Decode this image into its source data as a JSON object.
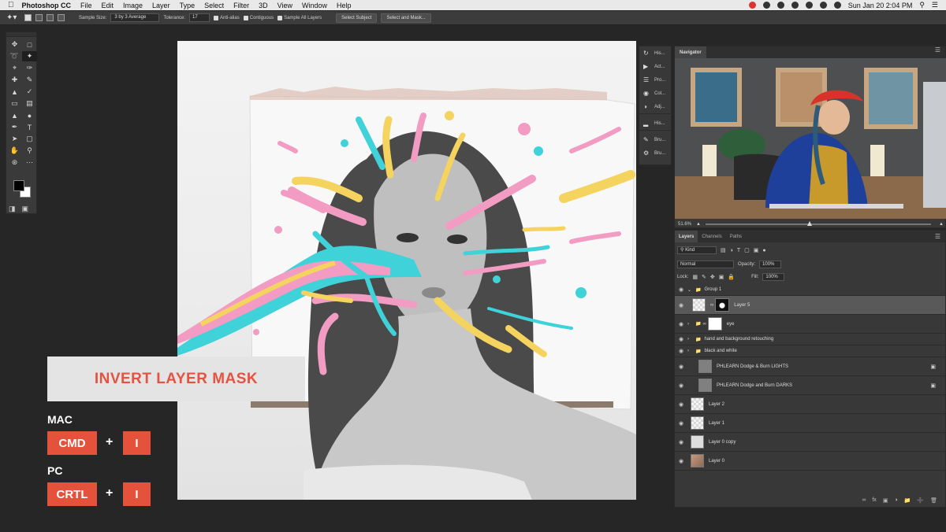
{
  "menubar": {
    "app_name": "Photoshop CC",
    "items": [
      "File",
      "Edit",
      "Image",
      "Layer",
      "Type",
      "Select",
      "Filter",
      "3D",
      "View",
      "Window",
      "Help"
    ],
    "clock": "Sun Jan 20  2:04 PM"
  },
  "options_bar": {
    "sample_size_label": "Sample Size:",
    "sample_size_value": "3 by 3 Average",
    "tolerance_label": "Tolerance:",
    "tolerance_value": "17",
    "anti_alias": "Anti-alias",
    "contiguous": "Contiguous",
    "sample_all_layers": "Sample All Layers",
    "select_subject": "Select Subject",
    "select_and_mask": "Select and Mask..."
  },
  "overlay": {
    "title": "INVERT LAYER MASK",
    "mac_label": "MAC",
    "mac_key1": "CMD",
    "mac_key2": "I",
    "pc_label": "PC",
    "pc_key1": "CRTL",
    "pc_key2": "I",
    "plus": "+"
  },
  "dock": {
    "items": [
      "His...",
      "Act...",
      "Pro...",
      "Col...",
      "Adj...",
      "His...",
      "Bru...",
      "Bru..."
    ]
  },
  "navigator": {
    "tab": "Navigator",
    "zoom": "51.6%"
  },
  "layers_panel": {
    "tabs": [
      "Layers",
      "Channels",
      "Paths"
    ],
    "filter_kind": "Kind",
    "blend_mode": "Normal",
    "opacity_label": "Opacity:",
    "opacity_value": "100%",
    "lock_label": "Lock:",
    "fill_label": "Fill:",
    "fill_value": "100%",
    "layers": [
      {
        "name": "Group 1"
      },
      {
        "name": "Layer 5"
      },
      {
        "name": "eye"
      },
      {
        "name": "hand and background retouching"
      },
      {
        "name": "black and white"
      },
      {
        "name": "PHLEARN Dodge & Burn LIGHTS"
      },
      {
        "name": "PHLEARN Dodge and Burn DARKS"
      },
      {
        "name": "Layer 2"
      },
      {
        "name": "Layer 1"
      },
      {
        "name": "Layer 0 copy"
      },
      {
        "name": "Layer 0"
      }
    ]
  },
  "colors": {
    "accent_red": "#e4523c",
    "panel_bg": "#383838",
    "app_bg": "#262626"
  }
}
